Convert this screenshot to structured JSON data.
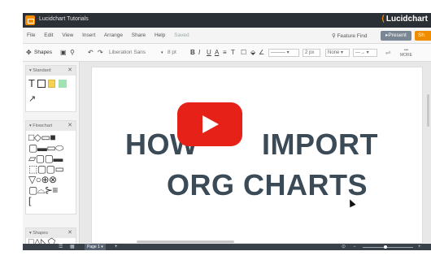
{
  "titlebar": {
    "title": "Lucidchart Tutorials",
    "brand": "Lucidchart"
  },
  "menubar": {
    "items": [
      "File",
      "Edit",
      "View",
      "Insert",
      "Arrange",
      "Share",
      "Help"
    ],
    "saved": "Saved",
    "feature_find": "Feature Find",
    "present": "Present",
    "share": "Sh"
  },
  "toolbar": {
    "shapes": "Shapes",
    "font": "Liberation Sans",
    "font_size": "8 pt",
    "line_width": "2 px",
    "arrow_start": "None",
    "more": "MORE"
  },
  "panel": {
    "standard": "Standard",
    "flowchart": "Flowchart",
    "shapes": "Shapes"
  },
  "canvas": {
    "line1a": "HOW",
    "line1b": "IMPORT",
    "line2": "ORG CHARTS"
  },
  "status": {
    "page": "Page 1",
    "plus": "+"
  },
  "colors": {
    "brand": "#f08c00",
    "play": "#e62117",
    "text": "#3b4a57"
  }
}
